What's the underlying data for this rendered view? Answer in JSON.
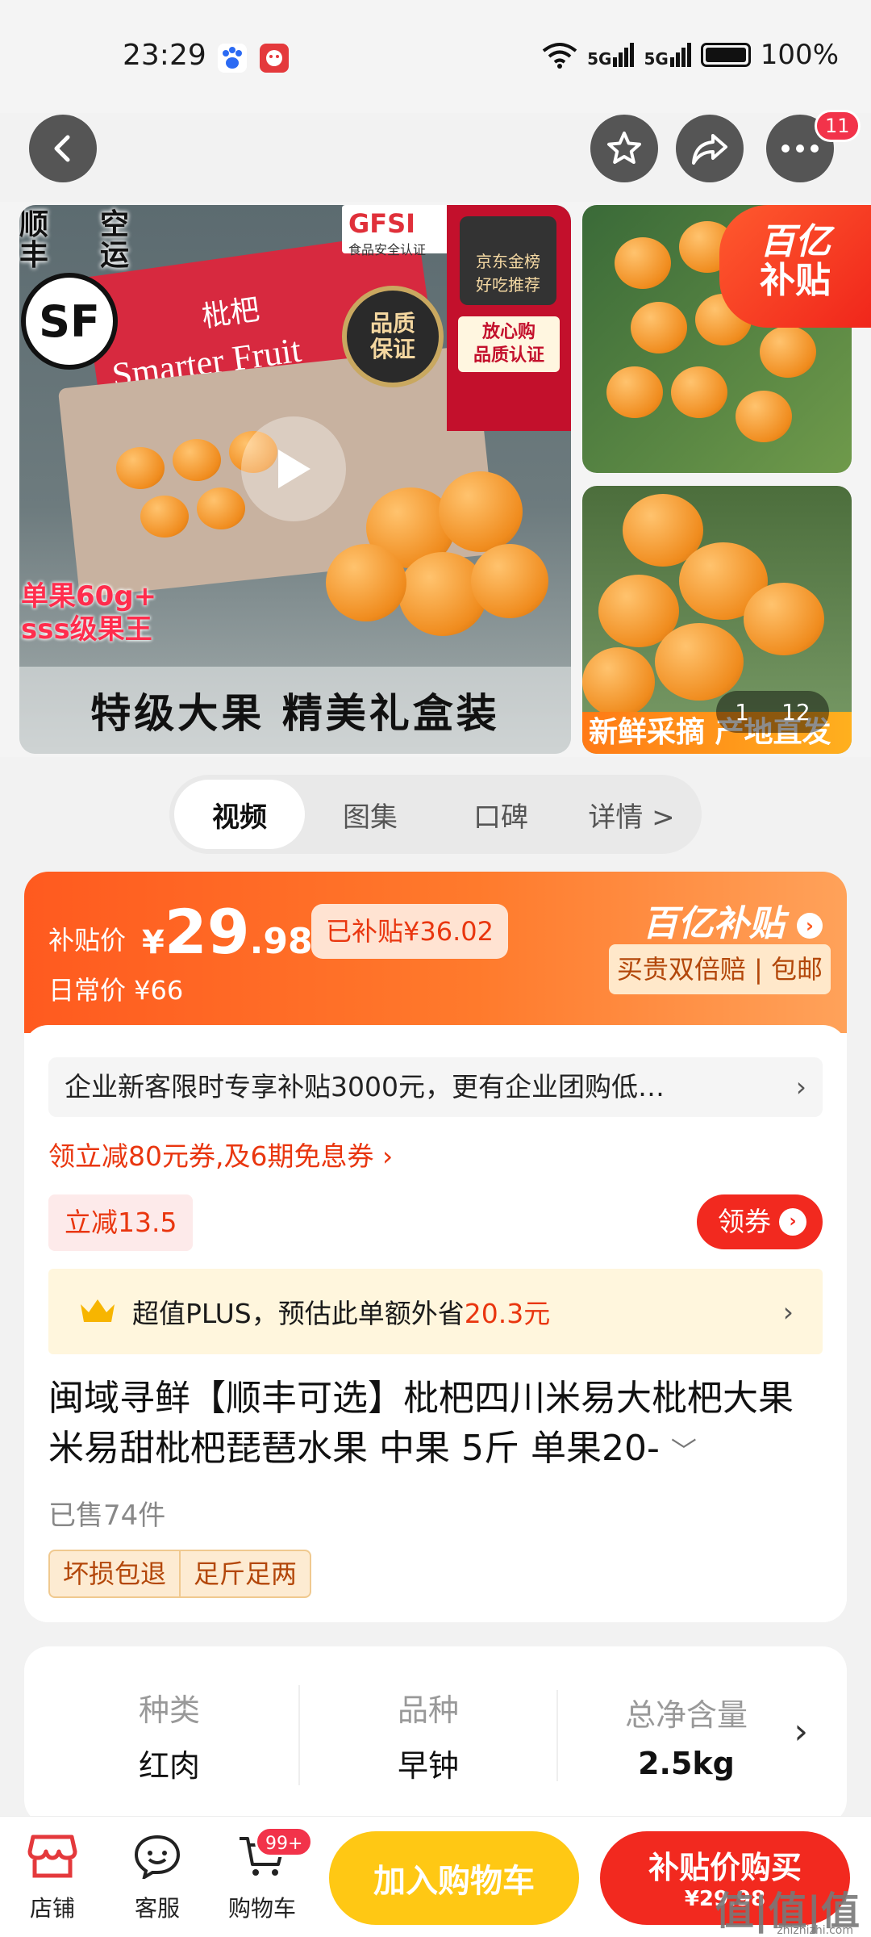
{
  "status_bar": {
    "time": "23:29",
    "net1": "5G",
    "net2": "5G",
    "battery": "100%"
  },
  "nav": {
    "notification_count": "11"
  },
  "gallery": {
    "sf_line1": "顺",
    "sf_line2": "丰",
    "sf_air1": "空",
    "sf_air2": "运",
    "sf_logo": "SF",
    "gfsi_main": "GFSI",
    "gfsi_sub": "食品安全认证",
    "jd_rank": "京东金榜\n好吃推荐",
    "trust_badge": "放心购\n品质认证",
    "seal_text": "品质\n保证",
    "box_brand": "Smarter Fruit",
    "box_cn": "枇杷",
    "promo_line1": "单果60g+",
    "promo_line2": "sss级果王",
    "caption": "特级大果  精美礼盒装",
    "yibt_l1": "百亿",
    "yibt_l2": "补贴",
    "side_caption": "新鲜采摘 产地直发",
    "counter_current": "1",
    "counter_total": "12"
  },
  "tabs": [
    {
      "label": "视频",
      "active": true
    },
    {
      "label": "图集",
      "active": false
    },
    {
      "label": "口碑",
      "active": false
    },
    {
      "label": "详情 >",
      "active": false
    }
  ],
  "price": {
    "subsidy_label": "补贴价",
    "currency": "¥",
    "integer": "29",
    "decimal": ".98",
    "subsidized": "已补贴¥36.02",
    "daily": "日常价 ¥66",
    "brand": "百亿补贴",
    "guarantee": "买贵双倍赔 | 包邮"
  },
  "promo": {
    "notice": "企业新客限时专享补贴3000元，更有企业团购低…",
    "coupon_link": "领立减80元券,及6期免息券 ›",
    "discount": "立减13.5",
    "coupon_btn": "领券",
    "plus_prefix": "超值PLUS，预估此单额外省",
    "plus_amount": "20.3元"
  },
  "product": {
    "title": "闽域寻鲜【顺丰可选】枇杷四川米易大枇杷大果米易甜枇杷琵琶水果 中果 5斤 单果20-",
    "sold": "已售74件",
    "tags": [
      "坏损包退",
      "足斤足两"
    ]
  },
  "specs": [
    {
      "label": "种类",
      "value": "红肉"
    },
    {
      "label": "品种",
      "value": "早钟"
    },
    {
      "label": "总净含量",
      "value": "2.5kg"
    }
  ],
  "bottom": {
    "store": "店铺",
    "service": "客服",
    "cart": "购物车",
    "cart_badge": "99+",
    "add_cart": "加入购物车",
    "buy_l1": "补贴价购买",
    "buy_l2": "¥29.98",
    "watermark": "值|值|值",
    "watermark_sub": "zhizhizhi.com"
  }
}
